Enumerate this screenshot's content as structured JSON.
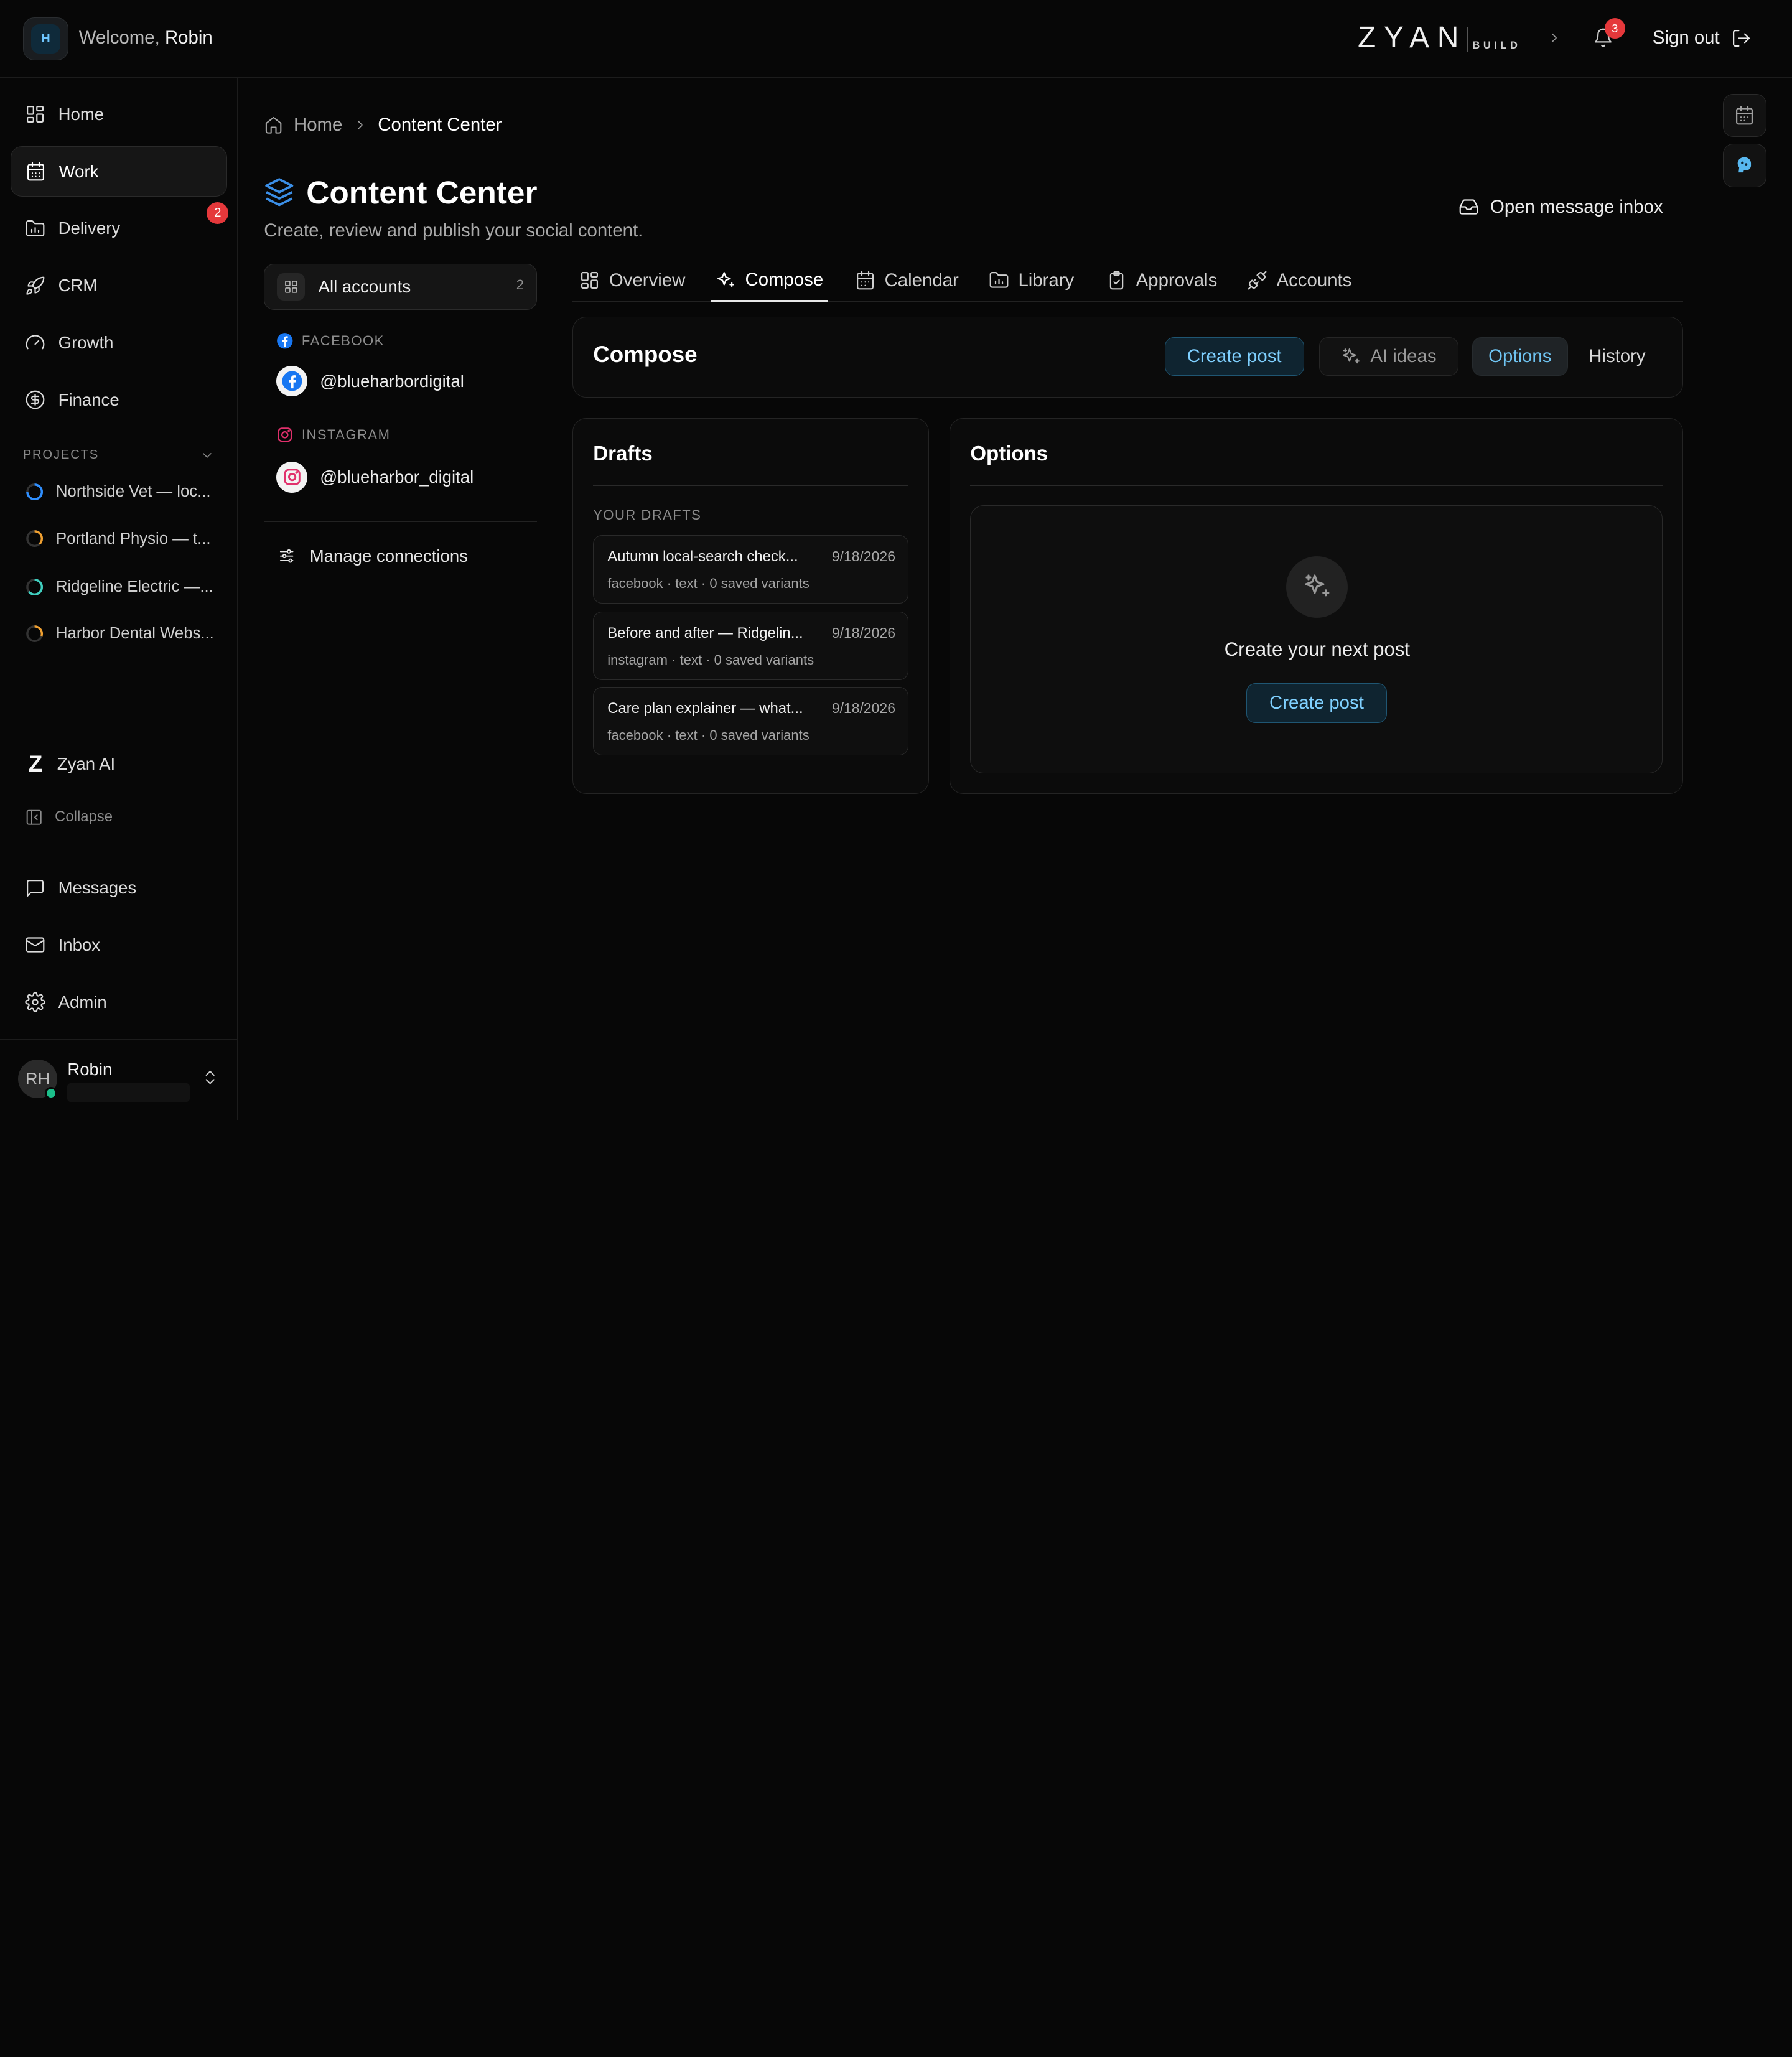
{
  "topbar": {
    "welcome_prefix": "Welcome,",
    "user_name": "Robin",
    "avatar_initial": "H",
    "brand_main": "ZYAN",
    "brand_sub": "BUILD",
    "notification_count": "3",
    "sign_out_label": "Sign out"
  },
  "sidebar": {
    "nav": [
      {
        "label": "Home",
        "icon": "grid-icon"
      },
      {
        "label": "Work",
        "icon": "calendar-icon",
        "active": true
      },
      {
        "label": "Delivery",
        "icon": "folder-icon",
        "badge": "2"
      },
      {
        "label": "CRM",
        "icon": "rocket-icon"
      },
      {
        "label": "Growth",
        "icon": "gauge-icon"
      },
      {
        "label": "Finance",
        "icon": "dollar-icon"
      }
    ],
    "projects_label": "PROJECTS",
    "projects": [
      {
        "name": "Northside Vet — loc...",
        "color": "#2f8fff"
      },
      {
        "name": "Portland Physio — t...",
        "color": "#f0a030"
      },
      {
        "name": "Ridgeline Electric —...",
        "color": "#3fd0c0"
      },
      {
        "name": "Harbor Dental Webs...",
        "color": "#f0a030"
      }
    ],
    "zyan_ai_label": "Zyan AI",
    "collapse_label": "Collapse",
    "bottom_nav": [
      {
        "label": "Messages",
        "icon": "message-icon"
      },
      {
        "label": "Inbox",
        "icon": "mail-icon"
      },
      {
        "label": "Admin",
        "icon": "gear-icon"
      }
    ],
    "user": {
      "initials": "RH",
      "name": "Robin"
    }
  },
  "breadcrumb": {
    "home": "Home",
    "current": "Content Center"
  },
  "page": {
    "title": "Content Center",
    "subtitle": "Create, review and publish your social content.",
    "inbox_button": "Open message inbox"
  },
  "accounts": {
    "all_label": "All accounts",
    "all_count": "2",
    "facebook_label": "FACEBOOK",
    "facebook_handle": "@blueharbordigital",
    "instagram_label": "INSTAGRAM",
    "instagram_handle": "@blueharbor_digital",
    "manage_label": "Manage connections"
  },
  "tabs": [
    {
      "label": "Overview",
      "icon": "grid-icon"
    },
    {
      "label": "Compose",
      "icon": "sparkle-icon",
      "active": true
    },
    {
      "label": "Calendar",
      "icon": "calendar-icon"
    },
    {
      "label": "Library",
      "icon": "folder-icon"
    },
    {
      "label": "Approvals",
      "icon": "clipboard-icon"
    },
    {
      "label": "Accounts",
      "icon": "plug-icon"
    }
  ],
  "compose": {
    "title": "Compose",
    "create_post": "Create post",
    "ai_ideas": "AI ideas",
    "options": "Options",
    "history": "History"
  },
  "drafts": {
    "title": "Drafts",
    "section_label": "YOUR DRAFTS",
    "items": [
      {
        "title": "Autumn local-search check...",
        "date": "9/18/2026",
        "meta": "facebook · text · 0 saved variants"
      },
      {
        "title": "Before and after — Ridgelin...",
        "date": "9/18/2026",
        "meta": "instagram · text · 0 saved variants"
      },
      {
        "title": "Care plan explainer — what...",
        "date": "9/18/2026",
        "meta": "facebook · text · 0 saved variants"
      }
    ]
  },
  "options_panel": {
    "title": "Options",
    "empty_text": "Create your next post",
    "empty_button": "Create post"
  },
  "colors": {
    "accent": "#7fd0ff",
    "badge": "#e5383b",
    "facebook": "#1877f2",
    "instagram": "#e1306c"
  }
}
